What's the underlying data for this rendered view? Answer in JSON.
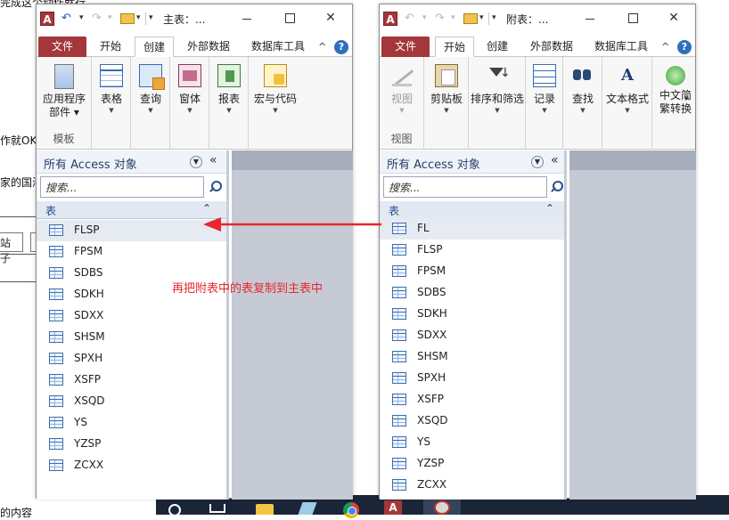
{
  "background": {
    "text_top": "完成这个动作就行",
    "text_ok": "作就OK",
    "text_home": "家的国海",
    "box1": "站子",
    "box2": "",
    "bottom_text": "的内容"
  },
  "colors": {
    "file_tab": "#a4373a",
    "annotation": "#e8262d",
    "taskbar": "#1a2538"
  },
  "main_window": {
    "title": "主表：...",
    "tabs": [
      "文件",
      "开始",
      "创建",
      "外部数据",
      "数据库工具"
    ],
    "active_tab": "创建",
    "ribbon": {
      "buttons": [
        {
          "label": "应用程序\n部件",
          "icon": "app-parts-icon"
        },
        {
          "label": "表格",
          "icon": "table-icon"
        },
        {
          "label": "查询",
          "icon": "query-icon"
        },
        {
          "label": "窗体",
          "icon": "form-icon"
        },
        {
          "label": "报表",
          "icon": "report-icon"
        },
        {
          "label": "宏与代码",
          "icon": "macro-icon"
        }
      ],
      "group_label": "模板"
    },
    "nav": {
      "title": "所有 Access 对象",
      "search_placeholder": "搜索...",
      "group": "表",
      "items": [
        "FLSP",
        "FPSM",
        "SDBS",
        "SDKH",
        "SDXX",
        "SHSM",
        "SPXH",
        "XSFP",
        "XSQD",
        "YS",
        "YZSP",
        "ZCXX"
      ],
      "selected": "FLSP"
    }
  },
  "attached_window": {
    "title": "附表：...",
    "tabs": [
      "文件",
      "开始",
      "创建",
      "外部数据",
      "数据库工具"
    ],
    "active_tab": "开始",
    "ribbon": {
      "buttons": [
        {
          "label": "视图",
          "icon": "view-icon",
          "disabled": true
        },
        {
          "label": "剪贴板",
          "icon": "clipboard-icon"
        },
        {
          "label": "排序和筛选",
          "icon": "filter-icon"
        },
        {
          "label": "记录",
          "icon": "records-icon"
        },
        {
          "label": "查找",
          "icon": "find-icon"
        },
        {
          "label": "文本格式",
          "icon": "text-format-icon"
        },
        {
          "label": "中文简\n繁转换",
          "icon": "chinese-convert-icon"
        }
      ],
      "group_label": "视图"
    },
    "nav": {
      "title": "所有 Access 对象",
      "search_placeholder": "搜索...",
      "group": "表",
      "items": [
        "FL",
        "FLSP",
        "FPSM",
        "SDBS",
        "SDKH",
        "SDXX",
        "SHSM",
        "SPXH",
        "XSFP",
        "XSQD",
        "YS",
        "YZSP",
        "ZCXX"
      ],
      "selected": "FL"
    }
  },
  "annotation": {
    "text": "再把附表中的表复制到主表中"
  }
}
